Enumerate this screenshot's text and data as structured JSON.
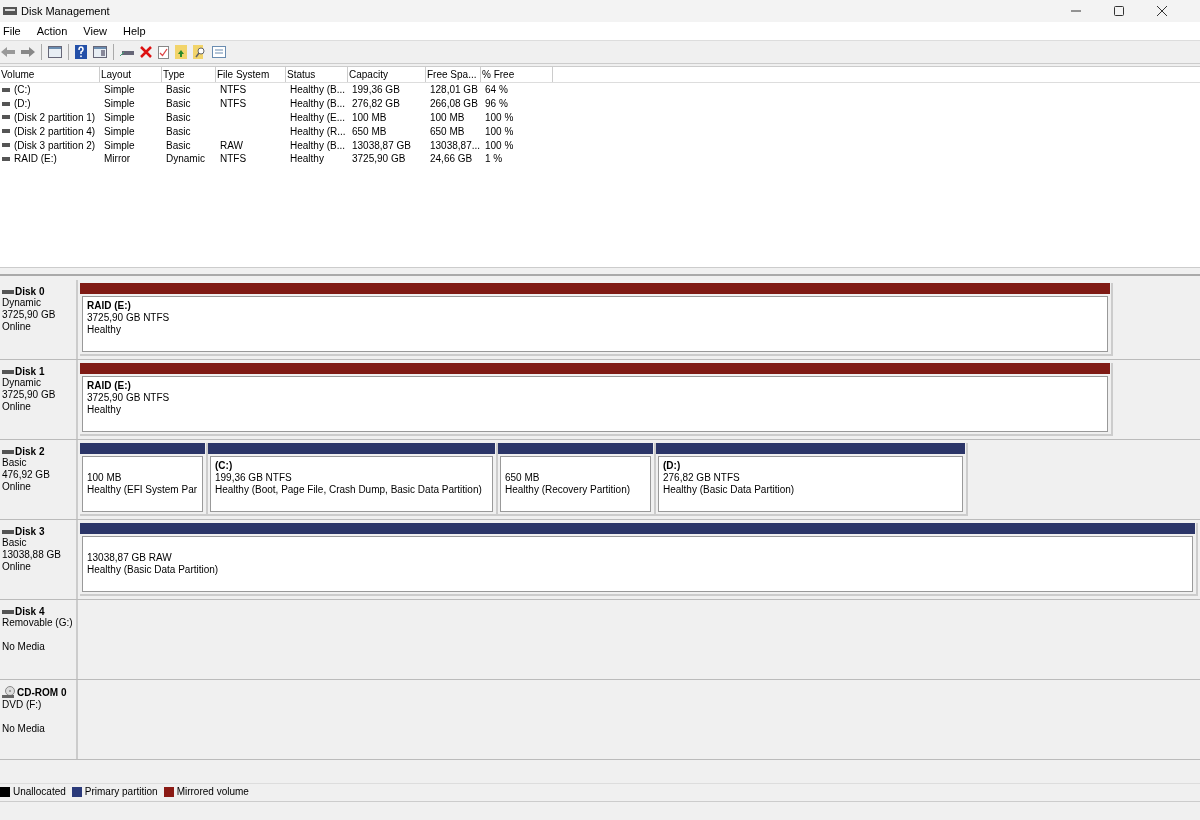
{
  "window": {
    "title": "Disk Management"
  },
  "menu": [
    "File",
    "Action",
    "View",
    "Help"
  ],
  "volume_table": {
    "columns": [
      "Volume",
      "Layout",
      "Type",
      "File System",
      "Status",
      "Capacity",
      "Free Spa...",
      "% Free"
    ],
    "rows": [
      [
        "(C:)",
        "Simple",
        "Basic",
        "NTFS",
        "Healthy (B...",
        "199,36 GB",
        "128,01 GB",
        "64 %"
      ],
      [
        "(D:)",
        "Simple",
        "Basic",
        "NTFS",
        "Healthy (B...",
        "276,82 GB",
        "266,08 GB",
        "96 %"
      ],
      [
        "(Disk 2 partition 1)",
        "Simple",
        "Basic",
        "",
        "Healthy (E...",
        "100 MB",
        "100 MB",
        "100 %"
      ],
      [
        "(Disk 2 partition 4)",
        "Simple",
        "Basic",
        "",
        "Healthy (R...",
        "650 MB",
        "650 MB",
        "100 %"
      ],
      [
        "(Disk 3 partition 2)",
        "Simple",
        "Basic",
        "RAW",
        "Healthy (B...",
        "13038,87 GB",
        "13038,87...",
        "100 %"
      ],
      [
        "RAID (E:)",
        "Mirror",
        "Dynamic",
        "NTFS",
        "Healthy",
        "3725,90 GB",
        "24,66 GB",
        "1 %"
      ]
    ]
  },
  "disks": [
    {
      "kind": "disk",
      "name": "Disk 0",
      "type": "Dynamic",
      "size": "3725,90 GB",
      "status": "Online",
      "partitions": [
        {
          "kind": "mirrored",
          "title": "RAID  (E:)",
          "size": "3725,90 GB NTFS",
          "status": "Healthy"
        }
      ]
    },
    {
      "kind": "disk",
      "name": "Disk 1",
      "type": "Dynamic",
      "size": "3725,90 GB",
      "status": "Online",
      "partitions": [
        {
          "kind": "mirrored",
          "title": "RAID  (E:)",
          "size": "3725,90 GB NTFS",
          "status": "Healthy"
        }
      ]
    },
    {
      "kind": "disk",
      "name": "Disk 2",
      "type": "Basic",
      "size": "476,92 GB",
      "status": "Online",
      "partitions": [
        {
          "kind": "primary",
          "size": "100 MB",
          "status": "Healthy (EFI System Par"
        },
        {
          "kind": "primary",
          "title": "(C:)",
          "size": "199,36 GB NTFS",
          "status": "Healthy (Boot, Page File, Crash Dump, Basic Data Partition)"
        },
        {
          "kind": "primary",
          "size": "650 MB",
          "status": "Healthy (Recovery Partition)"
        },
        {
          "kind": "primary",
          "title": "(D:)",
          "size": "276,82 GB NTFS",
          "status": "Healthy (Basic Data Partition)"
        }
      ]
    },
    {
      "kind": "disk",
      "name": "Disk 3",
      "type": "Basic",
      "size": "13038,88 GB",
      "status": "Online",
      "partitions": [
        {
          "kind": "primary",
          "size": "13038,87 GB RAW",
          "status": "Healthy (Basic Data Partition)"
        }
      ]
    },
    {
      "kind": "disk",
      "name": "Disk 4",
      "type": "Removable (G:)",
      "status": "No Media"
    },
    {
      "kind": "cdrom",
      "name": "CD-ROM 0",
      "type": "DVD (F:)",
      "status": "No Media"
    }
  ],
  "legend": [
    {
      "label": "Unallocated",
      "color": "#000000"
    },
    {
      "label": "Primary partition",
      "color": "#2b3a7a"
    },
    {
      "label": "Mirrored volume",
      "color": "#8b1a14"
    }
  ]
}
